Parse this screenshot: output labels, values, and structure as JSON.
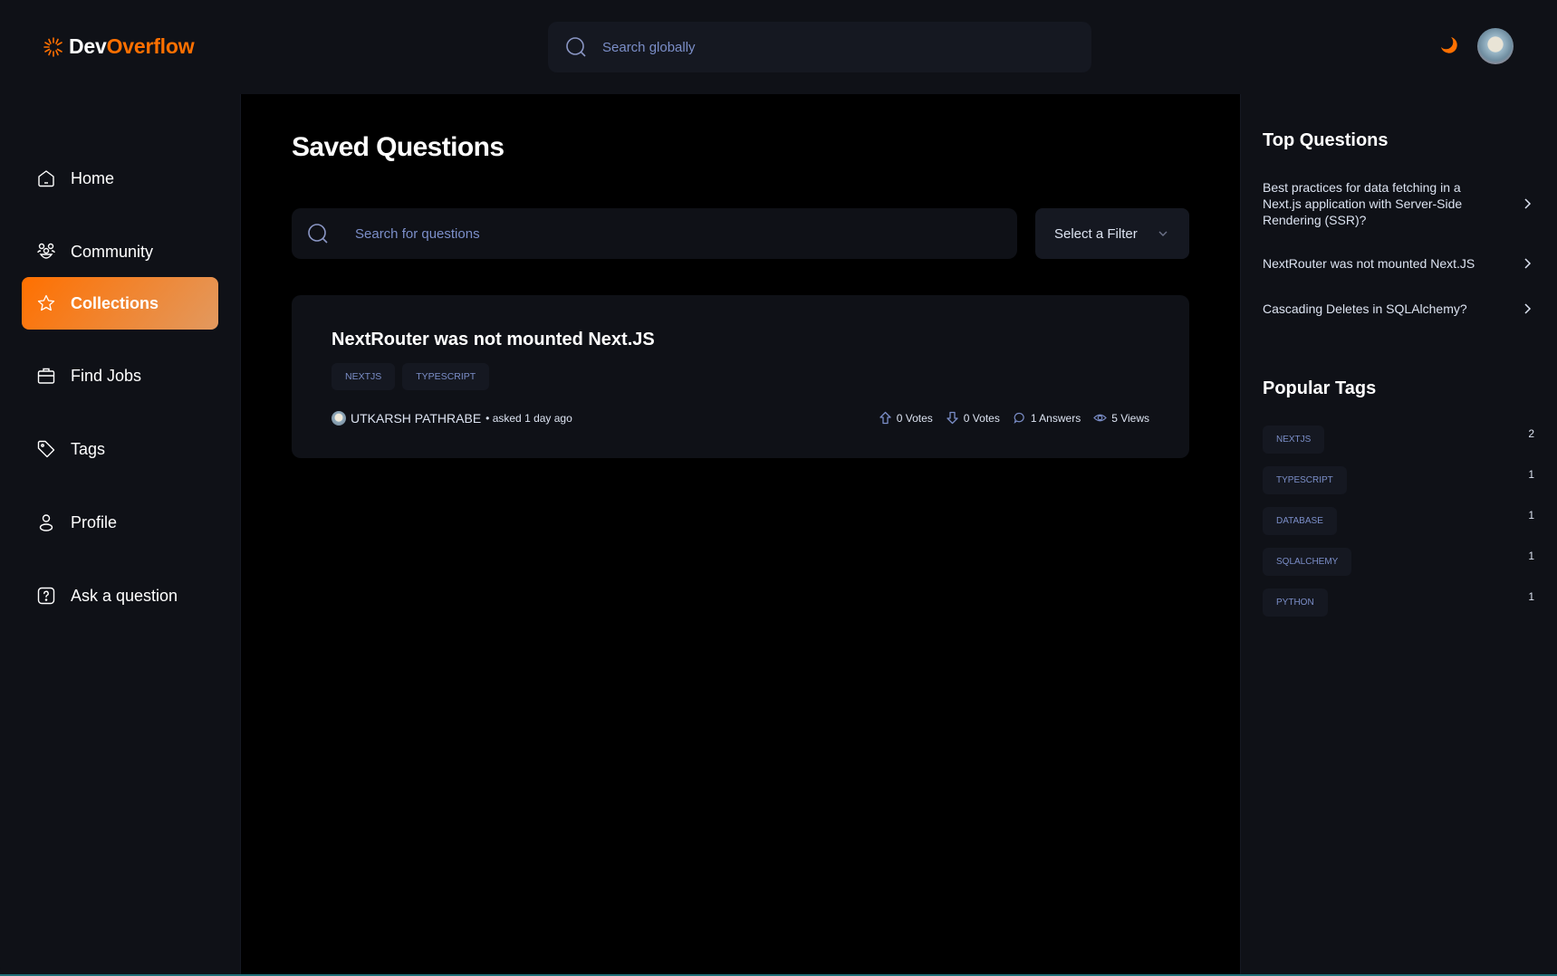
{
  "brand": {
    "prefix": "Dev",
    "suffix": "Overflow"
  },
  "header": {
    "search_placeholder": "Search globally",
    "theme_icon": "moon-icon",
    "avatar_alt": "User avatar"
  },
  "sidebar": {
    "items": [
      {
        "label": "Home",
        "icon": "home-icon",
        "active": false
      },
      {
        "label": "Community",
        "icon": "users-icon",
        "active": false
      },
      {
        "label": "Collections",
        "icon": "star-icon",
        "active": true
      },
      {
        "label": "Find Jobs",
        "icon": "briefcase-icon",
        "active": false
      },
      {
        "label": "Tags",
        "icon": "tag-icon",
        "active": false
      },
      {
        "label": "Profile",
        "icon": "user-icon",
        "active": false
      },
      {
        "label": "Ask a question",
        "icon": "question-icon",
        "active": false
      }
    ]
  },
  "main": {
    "title": "Saved Questions",
    "search_placeholder": "Search for questions",
    "filter_label": "Select a Filter",
    "questions": [
      {
        "title": "NextRouter was not mounted Next.JS",
        "tags": [
          "NEXTJS",
          "TYPESCRIPT"
        ],
        "author": "UTKARSH PATHRABE",
        "asked": "• asked 1 day ago",
        "upvotes": "0 Votes",
        "downvotes": "0 Votes",
        "answers": "1 Answers",
        "views": "5 Views"
      }
    ]
  },
  "right_sidebar": {
    "top_questions_title": "Top Questions",
    "top_questions": [
      "Best practices for data fetching in a Next.js application with Server-Side Rendering (SSR)?",
      "NextRouter was not mounted Next.JS",
      "Cascading Deletes in SQLAlchemy?"
    ],
    "popular_tags_title": "Popular Tags",
    "popular_tags": [
      {
        "name": "NEXTJS",
        "count": "2"
      },
      {
        "name": "TYPESCRIPT",
        "count": "1"
      },
      {
        "name": "DATABASE",
        "count": "1"
      },
      {
        "name": "SQLALCHEMY",
        "count": "1"
      },
      {
        "name": "PYTHON",
        "count": "1"
      }
    ]
  },
  "colors": {
    "accent": "#ff7000",
    "accent_gradient_end": "#e2995f",
    "background": "#0f1117",
    "main_background": "#000000",
    "chip_text": "#7b8ec8"
  }
}
